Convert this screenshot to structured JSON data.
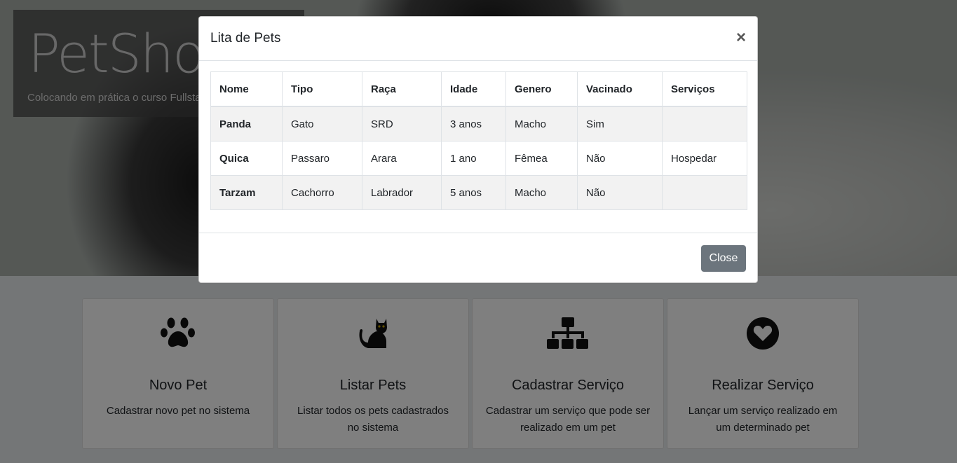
{
  "hero": {
    "title": "PetShop",
    "subtitle": "Colocando em prática o curso Fullstack"
  },
  "cards": [
    {
      "icon": "paw-icon",
      "title": "Novo Pet",
      "text": "Cadastrar novo pet no sistema"
    },
    {
      "icon": "cat-icon",
      "title": "Listar Pets",
      "text": "Listar todos os pets cadastrados no sistema"
    },
    {
      "icon": "sitemap-icon",
      "title": "Cadastrar Serviço",
      "text": "Cadastrar um serviço que pode ser realizado em um pet"
    },
    {
      "icon": "heart-circle-icon",
      "title": "Realizar Serviço",
      "text": "Lançar um serviço realizado em um determinado pet"
    }
  ],
  "modal": {
    "title": "Lita de Pets",
    "close_symbol": "×",
    "close_button": "Close",
    "columns": [
      "Nome",
      "Tipo",
      "Raça",
      "Idade",
      "Genero",
      "Vacinado",
      "Serviços"
    ],
    "rows": [
      [
        "Panda",
        "Gato",
        "SRD",
        "3 anos",
        "Macho",
        "Sim",
        ""
      ],
      [
        "Quica",
        "Passaro",
        "Arara",
        "1 ano",
        "Fêmea",
        "Não",
        "Hospedar"
      ],
      [
        "Tarzam",
        "Cachorro",
        "Labrador",
        "5 anos",
        "Macho",
        "Não",
        ""
      ]
    ]
  },
  "colors": {
    "button_secondary": "#6c757d",
    "backdrop": "rgba(0,0,0,0.5)"
  }
}
